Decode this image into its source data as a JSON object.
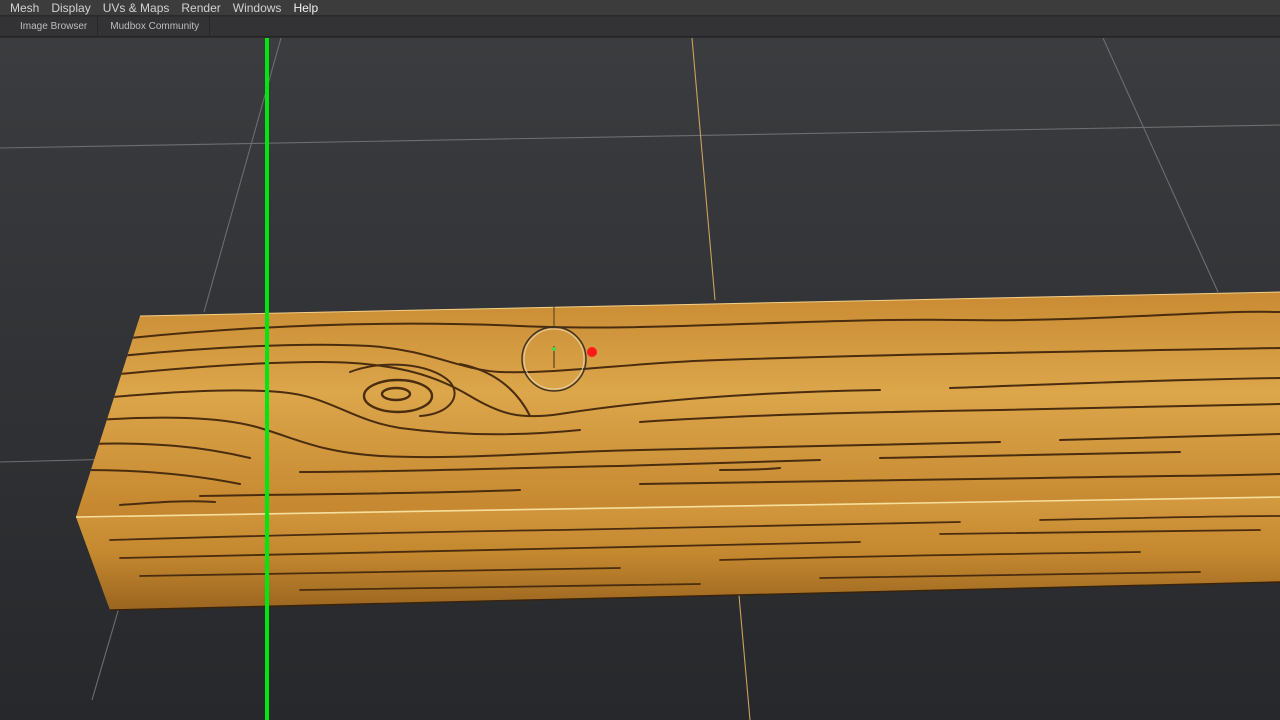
{
  "menubar": {
    "items": [
      {
        "label": "Mesh"
      },
      {
        "label": "Display"
      },
      {
        "label": "UVs & Maps"
      },
      {
        "label": "Render"
      },
      {
        "label": "Windows"
      },
      {
        "label": "Help"
      }
    ]
  },
  "tabs": [
    {
      "label": "Image Browser"
    },
    {
      "label": "Mudbox Community"
    }
  ],
  "viewport": {
    "colors": {
      "background_top": "#3a3c3f",
      "background_bottom": "#26282b",
      "grid": "#6b6e72",
      "axis_line": "#c9a35a",
      "divider": "#00e60f",
      "wood_light": "#d9a043",
      "wood_dark": "#8a5a1c",
      "grain": "#4a2c0e",
      "marker": "#ff1a1a"
    },
    "icons": [
      "brush-cursor-icon",
      "red-point-marker-icon"
    ]
  }
}
